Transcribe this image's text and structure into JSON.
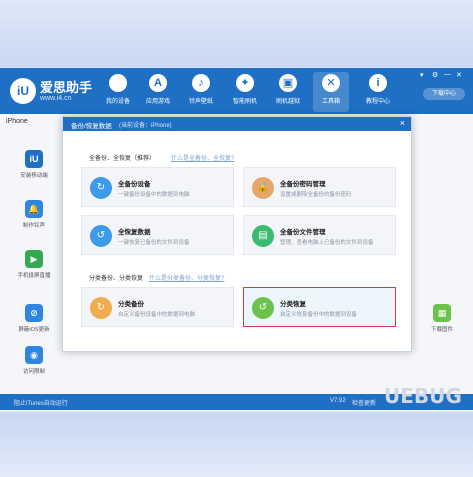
{
  "app": {
    "brand": "爱思助手",
    "url": "www.i4.cn",
    "logo_text": "iU",
    "download_label": "下载中心",
    "device_tab": "iPhone",
    "nav": [
      {
        "label": "我的设备",
        "icon": "apple-icon",
        "glyph": ""
      },
      {
        "label": "应用游戏",
        "icon": "appstore-icon",
        "glyph": "A"
      },
      {
        "label": "铃声壁纸",
        "icon": "bell-icon",
        "glyph": "♪"
      },
      {
        "label": "智能刷机",
        "icon": "flash-icon",
        "glyph": "✦"
      },
      {
        "label": "刷机越狱",
        "icon": "box-icon",
        "glyph": "▣"
      },
      {
        "label": "工具箱",
        "icon": "toolbox-icon",
        "glyph": "✕"
      },
      {
        "label": "教程中心",
        "icon": "info-icon",
        "glyph": "i"
      }
    ],
    "sidebar": [
      {
        "label": "安装移动端",
        "glyph": "iU",
        "color": "#1f6fc4"
      },
      {
        "label": "制作铃声",
        "glyph": "🔔",
        "color": "#2f86e0"
      },
      {
        "label": "手机投屏直播",
        "glyph": "▶",
        "color": "#34a853"
      },
      {
        "label": "屏蔽iOS更新",
        "glyph": "⊘",
        "color": "#2f86e0"
      },
      {
        "label": "访问限制",
        "glyph": "◉",
        "color": "#2f86e0"
      }
    ],
    "right_app": {
      "label": "下载固件",
      "glyph": "▦"
    },
    "status_left": "阻止iTunes自动运行",
    "version": "V7.92",
    "status_extra": "检查更新"
  },
  "dialog": {
    "title": "备份/恢复数据",
    "device": "(当前设备：iPhone)",
    "close_glyph": "×",
    "section1": {
      "title": "全备份、全恢复（推荐）",
      "link": "什么是全备份、全恢复?"
    },
    "section2": {
      "title": "分类备份、分类恢复",
      "link": "什么是分类备份、分类恢复?"
    },
    "cards": [
      {
        "title": "全备份设备",
        "desc": "一键备份设备中的数据到电脑",
        "color": "#3d9be9",
        "glyph": "↻"
      },
      {
        "title": "全备份密码管理",
        "desc": "设置或删除全备份的备份密码",
        "color": "#e6a86a",
        "glyph": "🔒"
      },
      {
        "title": "全恢复数据",
        "desc": "一键恢复已备份的文件到设备",
        "color": "#3d9be9",
        "glyph": "↺"
      },
      {
        "title": "全备份文件管理",
        "desc": "管理、查看电脑上已备份的文件到设备",
        "color": "#3cba6f",
        "glyph": "▤"
      },
      {
        "title": "分类备份",
        "desc": "自定义备份设备中的数据到电脑",
        "color": "#f0ad4e",
        "glyph": "↻"
      },
      {
        "title": "分类恢复",
        "desc": "自定义恢复备份中的数据到设备",
        "color": "#6cc24a",
        "glyph": "↺"
      }
    ]
  },
  "watermark": "UEBUG"
}
